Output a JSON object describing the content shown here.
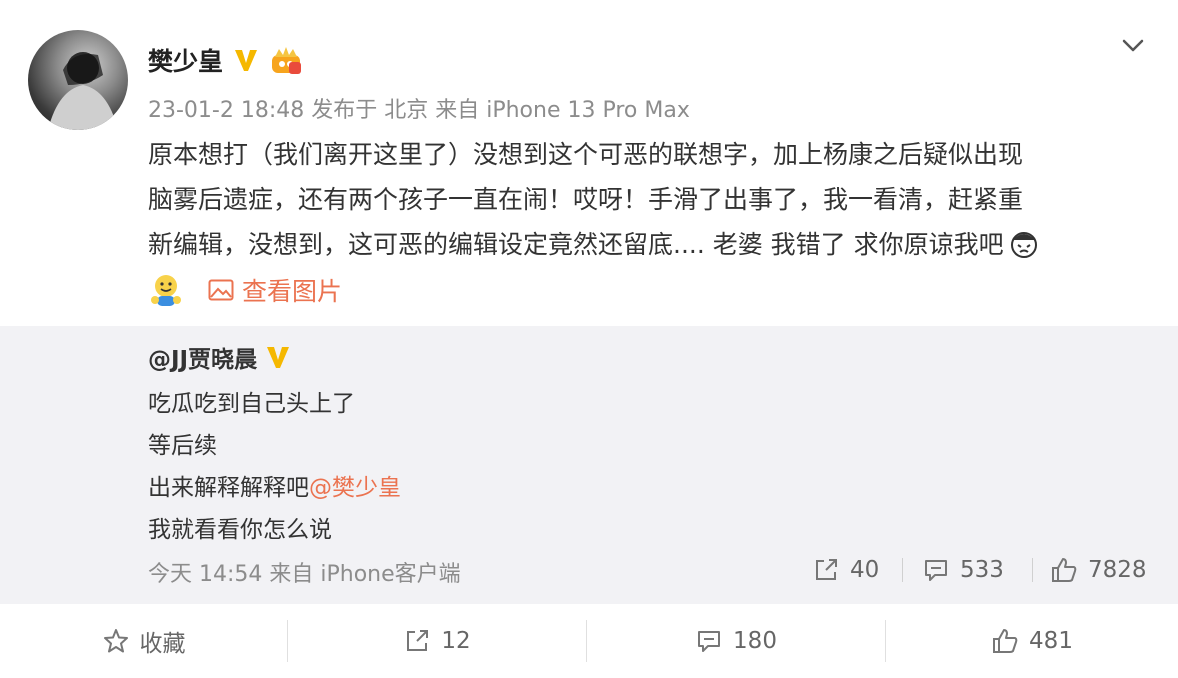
{
  "post": {
    "author": "樊少皇",
    "meta": "23-01-2 18:48 发布于 北京 来自 iPhone 13 Pro Max",
    "lines": [
      "原本想打（我们离开这里了）没想到这个可恶的联想字，加上杨康之后疑似出现",
      "脑雾后遗症，还有两个孩子一直在闹！哎呀！手滑了出事了，我一看清，赶紧重",
      "新编辑，没想到，这可恶的编辑设定竟然还留底.... 老婆 我错了 求你原谅我吧"
    ],
    "view_pictures_label": "查看图片"
  },
  "repost": {
    "author": "@JJ贾晓晨",
    "lines": [
      "吃瓜吃到自己头上了",
      "等后续",
      "出来解释解释吧"
    ],
    "mention": "@樊少皇",
    "last_line": "我就看看你怎么说",
    "meta": "今天 14:54 来自 iPhone客户端",
    "share_count": "40",
    "comment_count": "533",
    "like_count": "7828"
  },
  "footer": {
    "favorite_label": "收藏",
    "share_count": "12",
    "comment_count": "180",
    "like_count": "481"
  },
  "colors": {
    "accent": "#eb7350",
    "verified": "#f5b800",
    "repost_bg": "#f2f2f5"
  },
  "icons": [
    "chevron-down-icon",
    "verified-icon",
    "crown-badge-icon",
    "picture-icon",
    "share-icon",
    "comment-icon",
    "like-icon",
    "star-icon"
  ]
}
